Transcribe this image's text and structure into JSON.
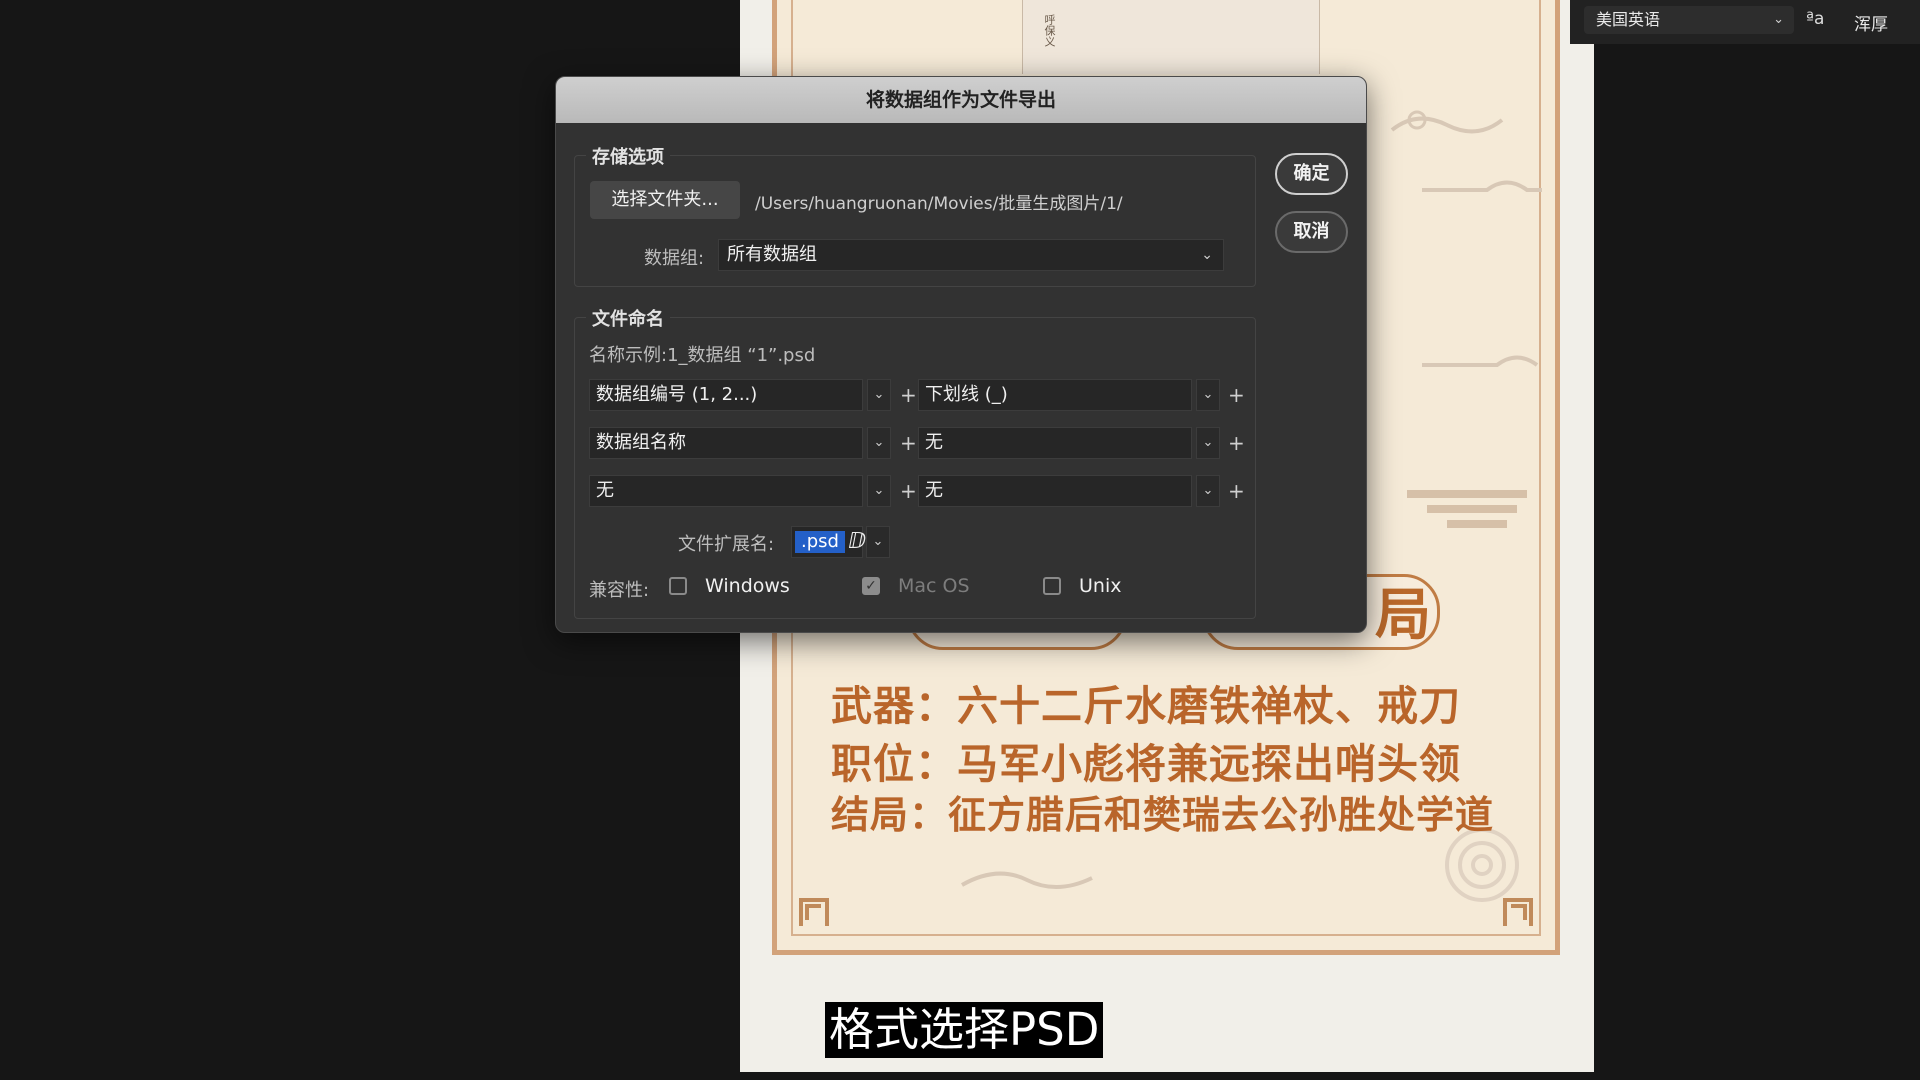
{
  "topbar": {
    "language": "美国英语",
    "aa_glyph": "ªa",
    "weight": "浑厚"
  },
  "dialog": {
    "title": "将数据组作为文件导出",
    "ok_label": "确定",
    "cancel_label": "取消",
    "storage": {
      "title": "存储选项",
      "choose_folder_label": "选择文件夹...",
      "path": "/Users/huangruonan/Movies/批量生成图片/1/",
      "dataset_label": "数据组:",
      "dataset_value": "所有数据组"
    },
    "naming": {
      "title": "文件命名",
      "example": "名称示例:1_数据组 “1”.psd",
      "rows": [
        {
          "left": "数据组编号 (1, 2...)",
          "right": "下划线 (_)"
        },
        {
          "left": "数据组名称",
          "right": "无"
        },
        {
          "left": "无",
          "right": "无"
        }
      ],
      "extension_label": "文件扩展名:",
      "extension_value": ".psd",
      "compat_label": "兼容性:",
      "windows_label": "Windows",
      "macos_label": "Mac OS",
      "unix_label": "Unix",
      "windows_checked": false,
      "macos_checked": true,
      "unix_checked": false
    }
  },
  "poster": {
    "lines": [
      "武器：六十二斤水磨铁禅杖、戒刀",
      "职位：马军小彪将兼远探出哨头领",
      "结局：征方腊后和樊瑞去公孙胜处学道"
    ],
    "plate_glyph": "局",
    "photo_text": "呼保义"
  },
  "caption": "格式选择PSD"
}
